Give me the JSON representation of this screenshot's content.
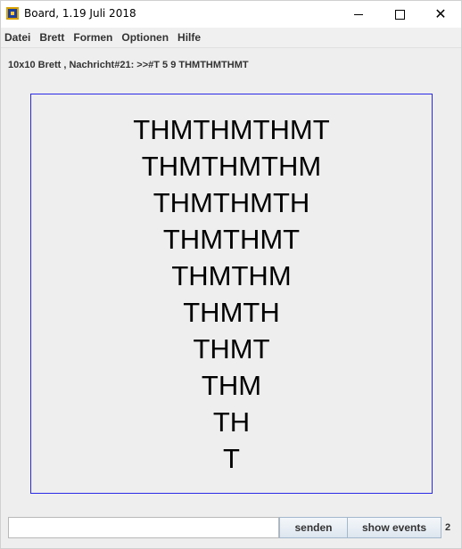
{
  "window": {
    "title": "Board, 1.19 Juli 2018",
    "icon": "board-app-icon",
    "controls": {
      "minimize_icon": "minimize-icon",
      "maximize_icon": "maximize-icon",
      "close_icon": "close-icon",
      "close_glyph": "✕"
    }
  },
  "menu": {
    "items": [
      "Datei",
      "Brett",
      "Formen",
      "Optionen",
      "Hilfe"
    ]
  },
  "status": {
    "text": "10x10 Brett , Nachricht#21: >>#T 5 9 THMTHMTHMT"
  },
  "board": {
    "border_color": "#2a2ae6",
    "lines": [
      "THMTHMTHMT",
      "THMTHMTHM",
      "THMTHMTH",
      "THMTHMT",
      "THMTHM",
      "THMTH",
      "THMT",
      "THM",
      "TH",
      "T"
    ]
  },
  "bottom": {
    "input_value": "",
    "input_placeholder": "",
    "send_label": "senden",
    "events_label": "show events",
    "counter": "2"
  }
}
